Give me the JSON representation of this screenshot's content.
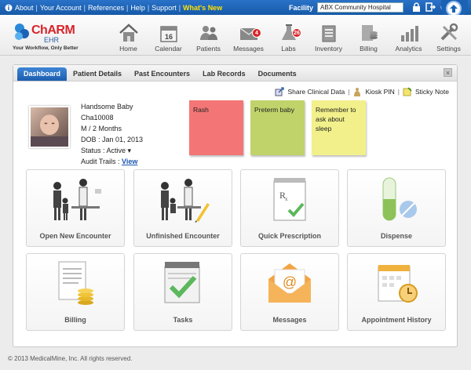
{
  "topbar": {
    "links": [
      "About",
      "Your Account",
      "References",
      "Help",
      "Support"
    ],
    "whats_new": "What's New",
    "facility_label": "Facility",
    "facility_value": "ABX Community Hospital",
    "icons": [
      "lock-icon",
      "logout-icon",
      "help-icon",
      "upload-icon"
    ]
  },
  "logo": {
    "name": "ChARM",
    "sub": "EHR",
    "tagline": "Your Workflow, Only Better"
  },
  "nav": [
    {
      "label": "Home",
      "icon": "home-icon"
    },
    {
      "label": "Calendar",
      "icon": "calendar-icon",
      "day": "16"
    },
    {
      "label": "Patients",
      "icon": "patients-icon"
    },
    {
      "label": "Messages",
      "icon": "messages-icon",
      "badge": "4"
    },
    {
      "label": "Labs",
      "icon": "labs-icon",
      "badge": "26"
    },
    {
      "label": "Inventory",
      "icon": "inventory-icon"
    },
    {
      "label": "Billing",
      "icon": "billing-icon"
    },
    {
      "label": "Analytics",
      "icon": "analytics-icon"
    },
    {
      "label": "Settings",
      "icon": "settings-icon"
    }
  ],
  "tabs": [
    "Dashboard",
    "Patient Details",
    "Past Encounters",
    "Lab Records",
    "Documents"
  ],
  "close_label": "×",
  "actions": {
    "share": "Share Clinical Data",
    "kiosk": "Kiosk PIN",
    "sticky": "Sticky Note",
    "separator": "|"
  },
  "patient": {
    "name": "Handsome Baby",
    "id": "Cha10008",
    "sex_age": "M / 2 Months",
    "dob": "DOB : Jan 01, 2013",
    "status": "Status : Active",
    "audit_label": "Audit Trails :",
    "audit_link": "View"
  },
  "stickies": [
    {
      "text": "Rash",
      "color": "#f37575"
    },
    {
      "text": "Preterm baby",
      "color": "#c0d36a"
    },
    {
      "text": "Remember to ask about sleep",
      "color": "#f2f08a"
    }
  ],
  "tiles": [
    {
      "label": "Open New Encounter",
      "icon": "new-encounter-icon"
    },
    {
      "label": "Unfinished Encounter",
      "icon": "unfinished-encounter-icon"
    },
    {
      "label": "Quick Prescription",
      "icon": "prescription-icon"
    },
    {
      "label": "Dispense",
      "icon": "dispense-icon"
    },
    {
      "label": "Billing",
      "icon": "billing-tile-icon"
    },
    {
      "label": "Tasks",
      "icon": "tasks-icon"
    },
    {
      "label": "Messages",
      "icon": "messages-tile-icon"
    },
    {
      "label": "Appointment History",
      "icon": "appointment-history-icon"
    }
  ],
  "footer": "© 2013 MedicalMine, Inc. All rights reserved.",
  "colors": {
    "topbar": "#1c62b4",
    "accent_red": "#d8242a",
    "tab_active": "#2a72c8",
    "whats_new": "#ffe100"
  }
}
